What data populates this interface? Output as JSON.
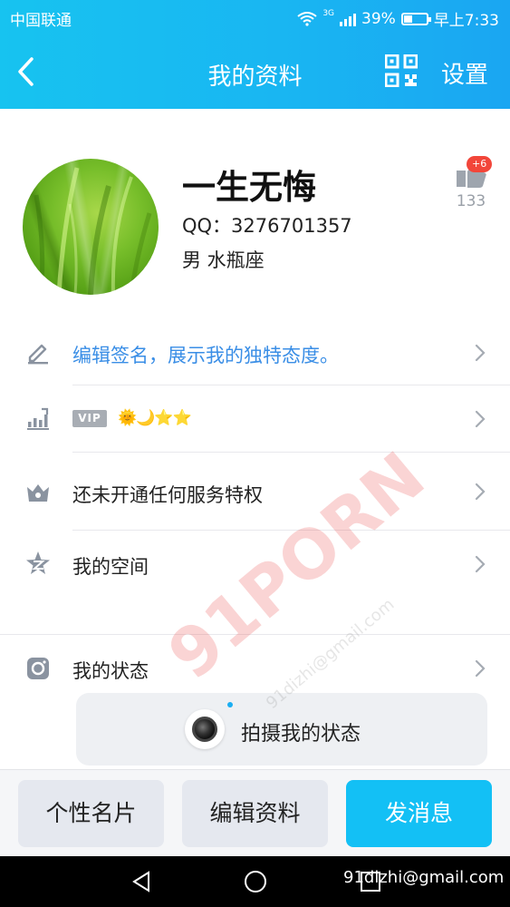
{
  "status_bar": {
    "carrier": "中国联通",
    "network": "3G",
    "battery": "39%",
    "battery_level": 0.39,
    "time": "早上7:33"
  },
  "header": {
    "title": "我的资料",
    "settings_label": "设置",
    "back_icon": "chevron-left-icon",
    "qr_icon": "qr-code-icon"
  },
  "profile": {
    "nickname": "一生无悔",
    "qq_line": "QQ：3276701357",
    "gender_zodiac": "男  水瓶座",
    "like_badge": "+6",
    "like_count": "133"
  },
  "rows": [
    {
      "label": "编辑签名，展示我的独特态度。",
      "icon": "pen-icon",
      "accent": "#3a8ee6"
    },
    {
      "label": "VIP",
      "icon": "level-chart-icon",
      "level_icons": "🌞🌙⭐⭐"
    },
    {
      "label": "还未开通任何服务特权",
      "icon": "crown-icon"
    },
    {
      "label": "我的空间",
      "icon": "qzone-star-icon"
    },
    {
      "label": "我的状态",
      "icon": "camera-status-icon"
    }
  ],
  "popup": {
    "text": "拍摄我的状态"
  },
  "actions": {
    "card": "个性名片",
    "edit": "编辑资料",
    "message": "发消息"
  },
  "colors": {
    "header_gradient_start": "#17c3f0",
    "header_gradient_end": "#1aa6f2",
    "primary_button": "#13c0f5",
    "link_blue": "#3a8ee6"
  },
  "watermark": {
    "big": "91PORN",
    "small": "91dizhi@gmail.com",
    "email": "91dizhi@gmail.com"
  }
}
